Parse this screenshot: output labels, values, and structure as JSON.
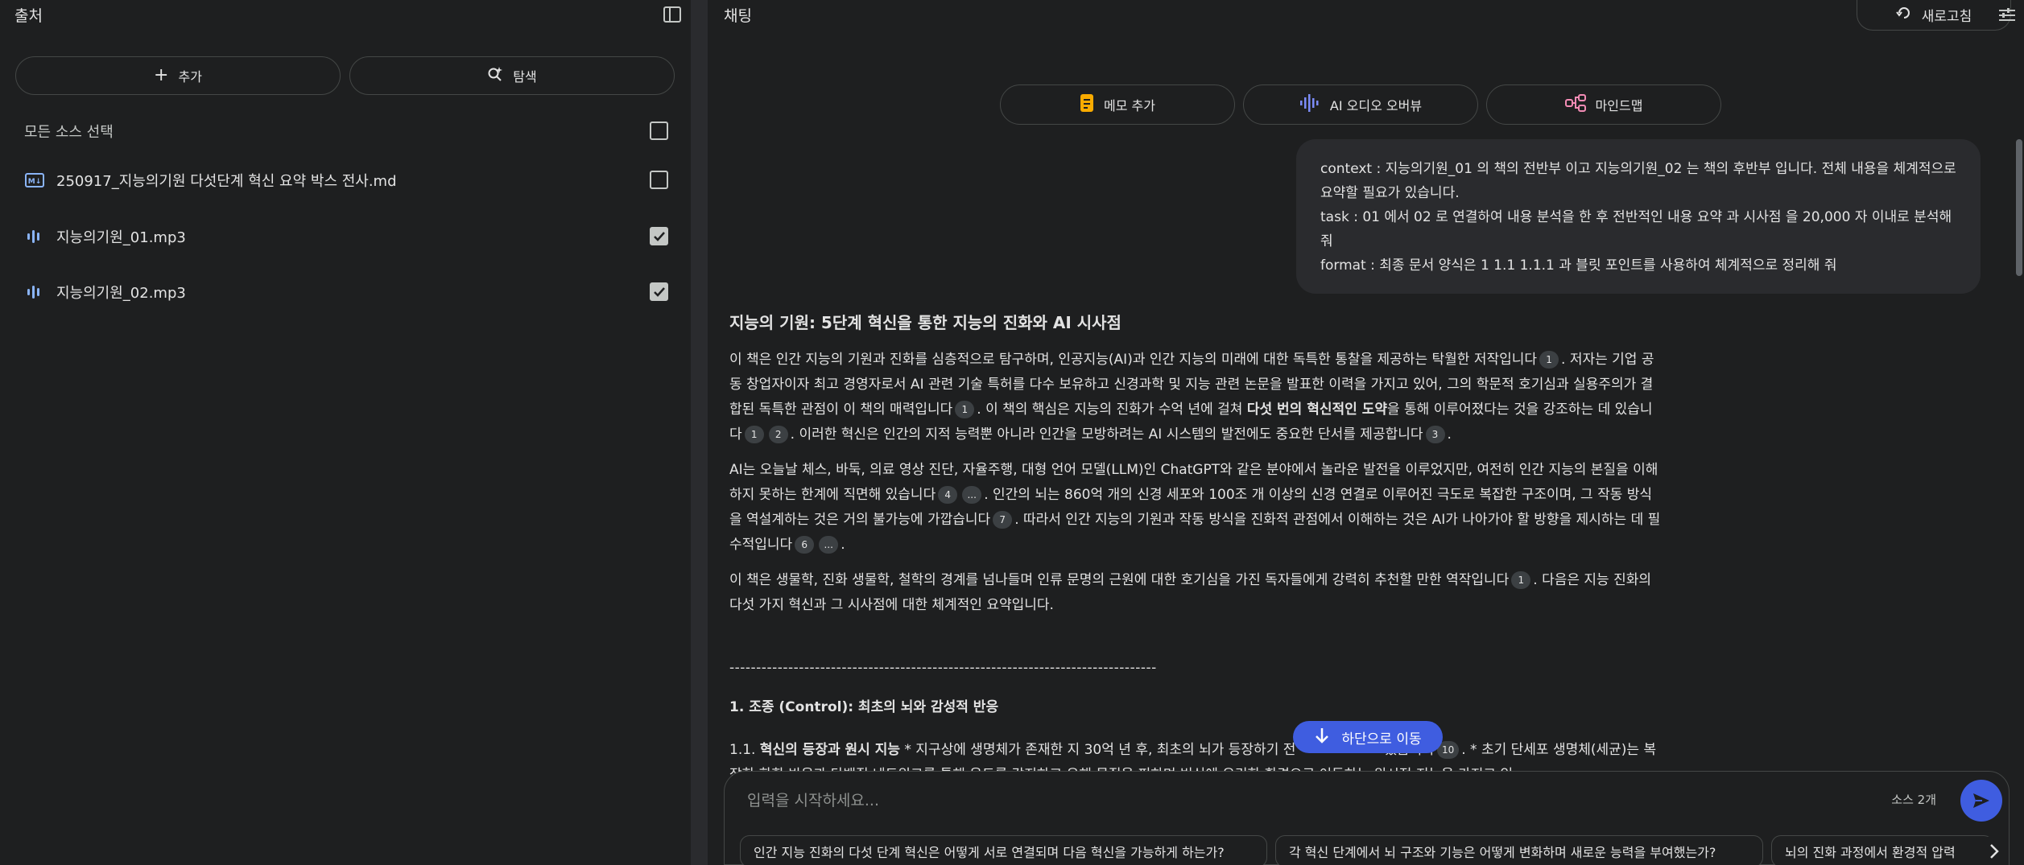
{
  "sources_panel": {
    "title": "출처",
    "add_label": "추가",
    "discover_label": "탐색",
    "select_all_label": "모든 소스 선택",
    "items": [
      {
        "name": "250917_지능의기원 다섯단계 혁신 요약 박스 전사.md",
        "checked": false,
        "icon": "markdown-icon"
      },
      {
        "name": "지능의기원_01.mp3",
        "checked": true,
        "icon": "audio-icon"
      },
      {
        "name": "지능의기원_02.mp3",
        "checked": true,
        "icon": "audio-icon"
      }
    ]
  },
  "chat_panel": {
    "title": "채팅",
    "refresh_label": "새로고침",
    "actions": [
      {
        "label": "메모 추가",
        "icon": "note-icon"
      },
      {
        "label": "AI 오디오 오버뷰",
        "icon": "waveform-icon"
      },
      {
        "label": "마인드맵",
        "icon": "mindmap-icon"
      }
    ],
    "user_message": [
      "context : 지능의기원_01 의  책의 전반부 이고  지능의기원_02 는 책의 후반부 입니다.  전체 내용을 체계적으로 요약할 필요가 있습니다.",
      "task :  01 에서 02 로 연결하여  내용 분석을 한 후 전반적인 내용 요약   과  시사점 을   20,000 자 이내로 분석해 줘",
      "format : 최종 문서 양식은  1  1.1  1.1.1  과 블릿 포인트를 사용하여 체계적으로 정리해 줘"
    ],
    "answer": {
      "title": "지능의 기원: 5단계 혁신을 통한 지능의 진화와 AI 시사점",
      "p1": {
        "t1": "이 책은 인간 지능의 기원과 진화를 심층적으로 탐구하며, 인공지능(AI)과 인간 지능의 미래에 대한 독특한 통찰을 제공하는 탁월한 저작입니다",
        "c1": "1",
        "t2": ". 저자는 기업 공동 창업자이자 최고 경영자로서 AI 관련 기술 특허를 다수 보유하고 신경과학 및 지능 관련 논문을 발표한 이력을 가지고 있어, 그의 학문적 호기심과 실용주의가 결합된 독특한 관점이 이 책의 매력입니다",
        "c2": "1",
        "t3": ". 이 책의 핵심은 지능의 진화가 수억 년에 걸쳐 ",
        "bold": "다섯 번의 혁신적인 도약",
        "t4": "을 통해 이루어졌다는 것을 강조하는 데 있습니다",
        "c3": "1",
        "c4": "2",
        "t5": ". 이러한 혁신은 인간의 지적 능력뿐 아니라 인간을 모방하려는 AI 시스템의 발전에도 중요한 단서를 제공합니다",
        "c5": "3",
        "t6": "."
      },
      "p2": {
        "t1": "AI는 오늘날 체스, 바둑, 의료 영상 진단, 자율주행, 대형 언어 모델(LLM)인 ChatGPT와 같은 분야에서 놀라운 발전을 이루었지만, 여전히 인간 지능의 본질을 이해하지 못하는 한계에 직면해 있습니다",
        "c1": "4",
        "c2": "...",
        "t2": ". 인간의 뇌는 860억 개의 신경 세포와 100조 개 이상의 신경 연결로 이루어진 극도로 복잡한 구조이며, 그 작동 방식을 역설계하는 것은 거의 불가능에 가깝습니다",
        "c3": "7",
        "t3": ". 따라서 인간 지능의 기원과 작동 방식을 진화적 관점에서 이해하는 것은 AI가 나아가야 할 방향을 제시하는 데 필수적입니다",
        "c4": "6",
        "c5": "...",
        "t4": "."
      },
      "p3": {
        "t1": "이 책은 생물학, 진화 생물학, 철학의 경계를 넘나들며 인류 문명의 근원에 대한 호기심을 가진 독자들에게 강력히 추천할 만한 역작입니다",
        "c1": "1",
        "t2": ". 다음은 지능 진화의 다섯 가지 혁신과 그 시사점에 대한 체계적인 요약입니다."
      },
      "divider": "--------------------------------------------------------------------------------",
      "section1_title": "1. 조종 (Control): 최초의 뇌와 감성적 반응",
      "s11": {
        "prefix": "1.1. ",
        "bold": "혁신의 등장과 원시 지능",
        "t1": " *   지구상에 생명체가 존재한 지 30억 년 후, 최초의 뇌가 등장하기 전",
        "t2": "했습니다",
        "c1": "10",
        "t3": ". *   초기 단세포 생명체(세균)는 복잡한 화학 반응과 단백질 네트워크를 통해 온도를 감지하고 유해 물질을 피하며 번식에 유리한 환경으로 이동하는 원시적 지능을 가지고 있"
      }
    },
    "scroll_down_label": "하단으로 이동",
    "input_placeholder": "입력을 시작하세요...",
    "source_count": "소스 2개",
    "suggestions": [
      "인간 지능 진화의 다섯 단계 혁신은 어떻게 서로 연결되며 다음 혁신을 가능하게 하는가?",
      "각 혁신 단계에서 뇌 구조와 기능은 어떻게 변화하며 새로운 능력을 부여했는가?",
      "뇌의 진화 과정에서 환경적 압력"
    ]
  },
  "colors": {
    "background": "#1e1f20",
    "accent": "#3f5de0"
  }
}
